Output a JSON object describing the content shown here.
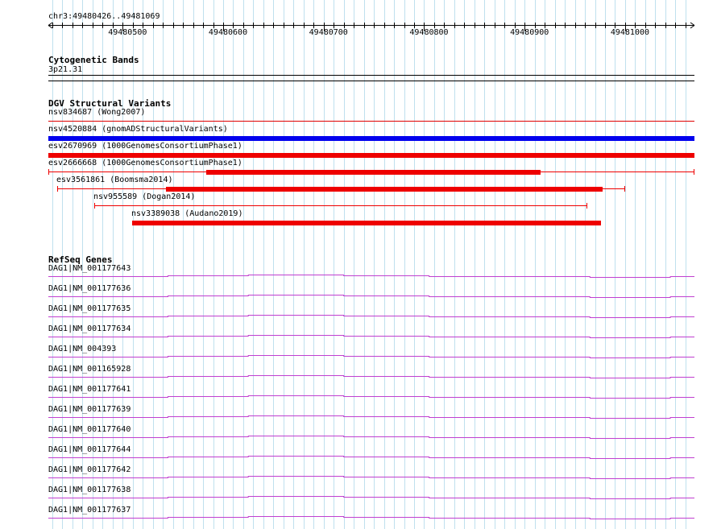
{
  "ruler": {
    "position_label": "chr3:49480426..49481069",
    "start": 49480426,
    "end": 49481069,
    "ticks": [
      "49480500",
      "49480600",
      "49480700",
      "49480800",
      "49480900",
      "49481000"
    ]
  },
  "cytoband": {
    "title": "Cytogenetic Bands",
    "band_label": "3p21.31"
  },
  "dgv": {
    "title": "DGV Structural Variants",
    "variants": [
      {
        "label": "nsv834687 (Wong2007)",
        "start": 49480426,
        "end": 49481069,
        "style": "thin",
        "color": "#e00000"
      },
      {
        "label": "nsv4520884 (gnomADStructuralVariants)",
        "start": 49480426,
        "end": 49481069,
        "style": "thick",
        "color": "#0000ee"
      },
      {
        "label": "esv2670969 (1000GenomesConsortiumPhase1)",
        "start": 49480426,
        "end": 49481069,
        "style": "thick",
        "color": "#ee0000"
      },
      {
        "label": "esv2666668 (1000GenomesConsortiumPhase1)",
        "start": 49480426,
        "end": 49481069,
        "thick_start": 49480583,
        "thick_end": 49480916,
        "style": "mixed",
        "color": "#ee0000"
      },
      {
        "label": "esv3561861 (Boomsma2014)",
        "start": 49480435,
        "end": 49481000,
        "thick_start": 49480543,
        "thick_end": 49480978,
        "style": "mixed",
        "color": "#ee0000"
      },
      {
        "label": "nsv955589 (Dogan2014)",
        "start": 49480472,
        "end": 49480962,
        "style": "thin-capped",
        "color": "#ee0000"
      },
      {
        "label": "nsv3389038 (Audano2019)",
        "start": 49480509,
        "end": 49480976,
        "style": "thick",
        "color": "#ee0000"
      }
    ]
  },
  "refseq": {
    "title": "RefSeq Genes",
    "color": "#c040d0",
    "genes": [
      "DAG1|NM_001177643",
      "DAG1|NM_001177636",
      "DAG1|NM_001177635",
      "DAG1|NM_001177634",
      "DAG1|NM_004393",
      "DAG1|NM_001165928",
      "DAG1|NM_001177641",
      "DAG1|NM_001177639",
      "DAG1|NM_001177640",
      "DAG1|NM_001177644",
      "DAG1|NM_001177642",
      "DAG1|NM_001177638",
      "DAG1|NM_001177637"
    ]
  }
}
